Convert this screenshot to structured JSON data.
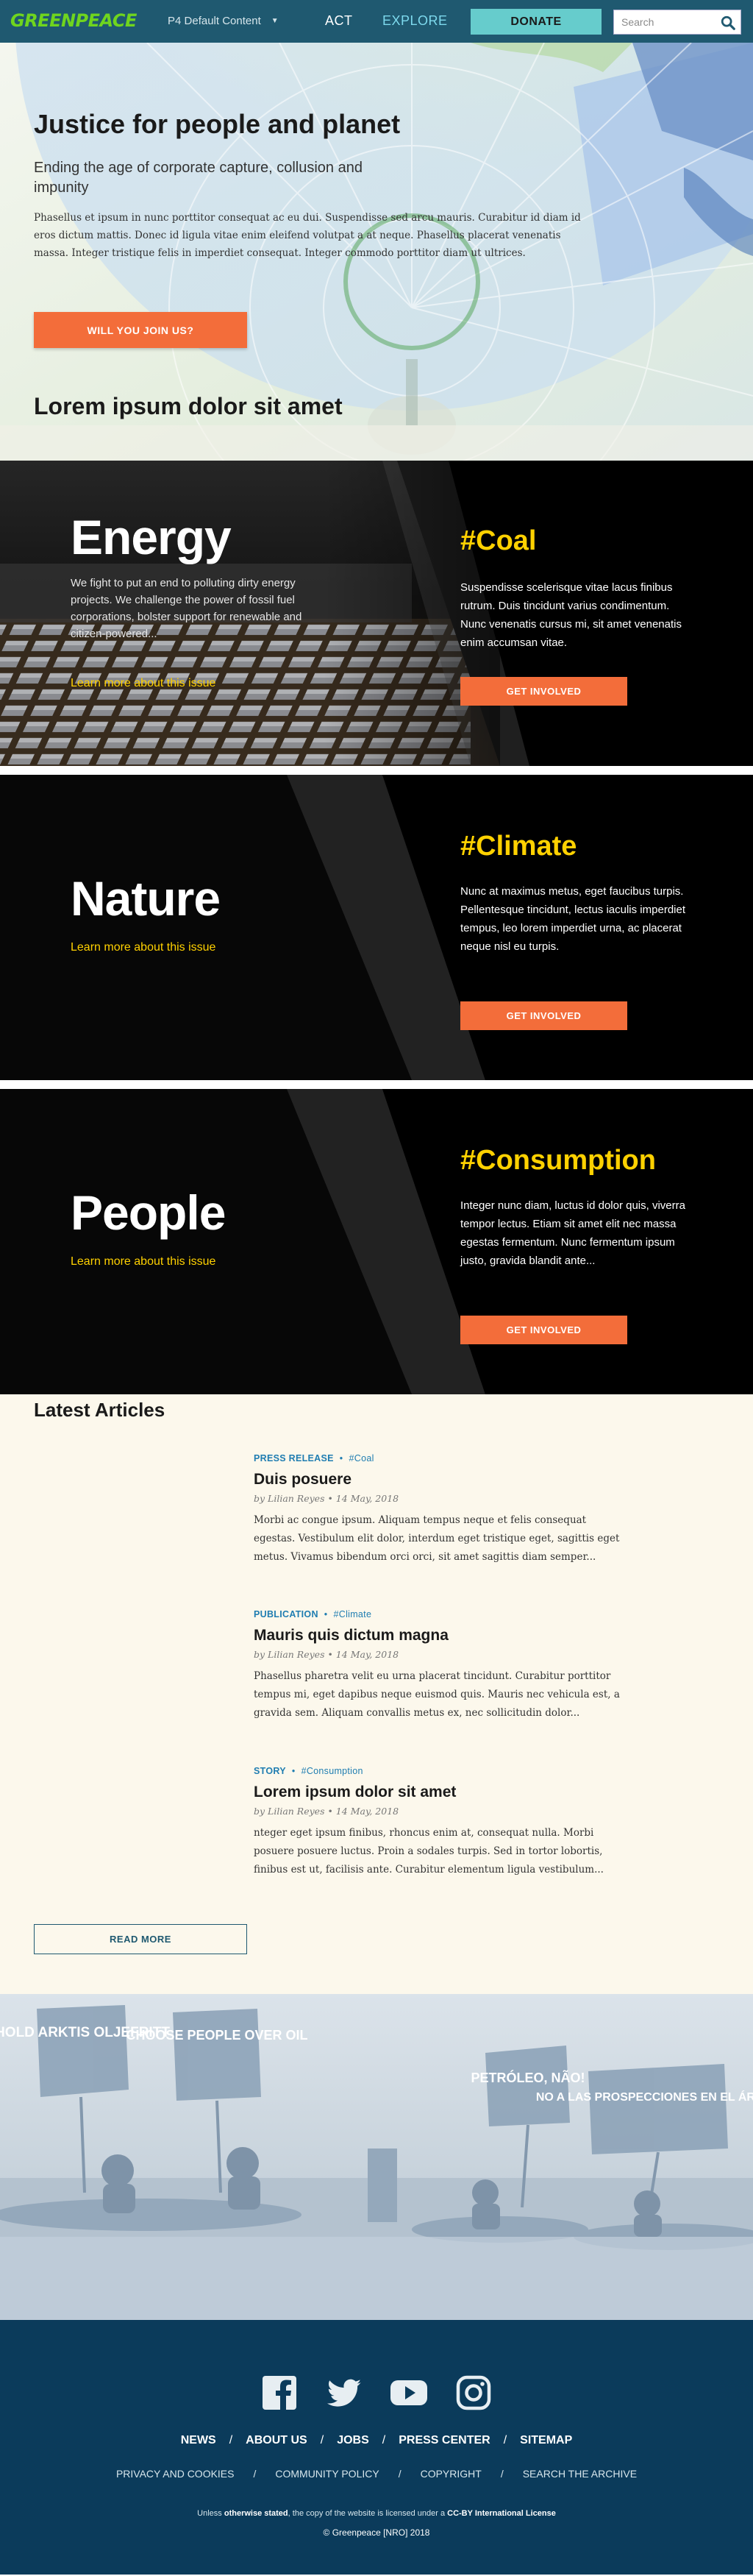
{
  "nav": {
    "logo": "GREENPEACE",
    "dropdown_label": "P4 Default Content",
    "act": "ACT",
    "explore": "EXPLORE",
    "donate": "DONATE",
    "search_placeholder": "Search",
    "colors": {
      "bar": "#1f5970",
      "logo": "#6fd51e",
      "explore": "#7dd9ed",
      "donate": "#66cccc"
    }
  },
  "hero": {
    "title": "Justice for people and planet",
    "subtitle": "Ending the age of corporate capture, collusion and impunity",
    "body": "Phasellus et ipsum in nunc porttitor consequat ac eu dui. Suspendisse sed arcu mauris. Curabitur id diam id eros dictum mattis. Donec id ligula vitae enim eleifend volutpat a at neque. Phasellus placerat venenatis massa. Integer tristique felis in imperdiet consequat. Integer commodo porttitor diam ut ultrices.",
    "cta": "WILL YOU JOIN US?",
    "section_heading": "Lorem ipsum dolor sit amet"
  },
  "issues": [
    {
      "name": "Energy",
      "description": "We fight to put an end to polluting dirty energy projects. We challenge the power of fossil fuel corporations, bolster support for renewable and citizen-powered...",
      "link": "Learn more about this issue",
      "tag": "#Coal",
      "tag_description": "Suspendisse scelerisque vitae lacus finibus rutrum. Duis tincidunt varius condimentum. Nunc venenatis cursus mi, sit amet venenatis enim accumsan vitae.",
      "button": "GET INVOLVED"
    },
    {
      "name": "Nature",
      "description": "",
      "link": "Learn more about this issue",
      "tag": "#Climate",
      "tag_description": "Nunc at maximus metus, eget faucibus turpis. Pellentesque tincidunt, lectus iaculis imperdiet tempus, leo lorem imperdiet urna, ac placerat neque nisl eu turpis.",
      "button": "GET INVOLVED"
    },
    {
      "name": "People",
      "description": "",
      "link": "Learn more about this issue",
      "tag": "#Consumption",
      "tag_description": "Integer nunc diam, luctus id dolor quis, viverra tempor lectus. Etiam sit amet elit nec massa egestas fermentum. Nunc fermentum ipsum justo, gravida blandit ante...",
      "button": "GET INVOLVED"
    }
  ],
  "articles": {
    "title": "Latest Articles",
    "items": [
      {
        "type": "PRESS RELEASE",
        "tag": "#Coal",
        "title": "Duis posuere",
        "byline": "by Lilian Reyes • 14 May, 2018",
        "excerpt": "Morbi ac congue ipsum. Aliquam tempus neque et felis consequat egestas. Vestibulum elit dolor, interdum eget tristique eget, sagittis eget metus. Vivamus bibendum orci orci, sit amet sagittis diam semper..."
      },
      {
        "type": "PUBLICATION",
        "tag": "#Climate",
        "title": "Mauris quis dictum magna",
        "byline": "by Lilian Reyes • 14 May, 2018",
        "excerpt": "Phasellus pharetra velit eu urna placerat tincidunt. Curabitur porttitor tempus mi, eget dapibus neque euismod quis. Mauris nec vehicula est, a gravida sem. Aliquam convallis metus ex, nec sollicitudin dolor..."
      },
      {
        "type": "STORY",
        "tag": "#Consumption",
        "title": "Lorem ipsum dolor sit amet",
        "byline": "by Lilian Reyes • 14 May, 2018",
        "excerpt": "nteger eget ipsum finibus, rhoncus enim at, consequat nulla. Morbi posuere posuere luctus. Proin a sodales turpis. Sed in tortor lobortis, finibus est ut, facilisis ante. Curabitur elementum ligula vestibulum..."
      }
    ],
    "read_more": "READ MORE"
  },
  "protest": {
    "signs": [
      "HOLD ARKTIS OLJEFRITT",
      "CHOOSE PEOPLE OVER OIL",
      "PETRÓLEO, NÃO!",
      "NO A LAS PROSPECCIONES EN EL ÁRTICO"
    ]
  },
  "footer": {
    "social_icons": [
      "facebook-icon",
      "twitter-icon",
      "youtube-icon",
      "instagram-icon"
    ],
    "nav": [
      "NEWS",
      "ABOUT US",
      "JOBS",
      "PRESS CENTER",
      "SITEMAP"
    ],
    "sub_nav": [
      "PRIVACY AND COOKIES",
      "COMMUNITY POLICY",
      "COPYRIGHT",
      "SEARCH THE ARCHIVE"
    ],
    "license_prefix": "Unless",
    "license_bold1": "otherwise stated",
    "license_middle": ", the copy of the website is licensed under a",
    "license_bold2": "CC-BY International License",
    "copyright": "Greenpeace [NRO] 2018",
    "colors": {
      "background": "#0b3b5b"
    }
  }
}
